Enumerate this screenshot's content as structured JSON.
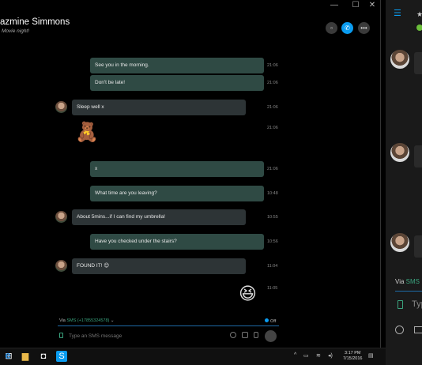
{
  "window": {
    "controls": {
      "minimize": "—",
      "maximize": "☐",
      "close": "✕"
    },
    "header": {
      "contact_name": "azmine Simmons",
      "mood": "Movie night!"
    }
  },
  "messages": [
    {
      "dir": "out",
      "text": "See you in the morning.",
      "time": "21:06"
    },
    {
      "dir": "out",
      "text": "Don't be late!",
      "time": "21:06"
    },
    {
      "dir": "in",
      "text": "Sleep well x",
      "time": "21:06"
    },
    {
      "dir": "in",
      "emoticon": "teddy-bear",
      "time": "21:06"
    },
    {
      "dir": "out",
      "text": "x",
      "time": "21:06"
    },
    {
      "dir": "out",
      "text": "What time are you leaving?",
      "time": "10:48"
    },
    {
      "dir": "in",
      "text": "About 5mins...if I can find my umbrella!",
      "time": "10:55"
    },
    {
      "dir": "out",
      "text": "Have you checked under the stairs?",
      "time": "10:56"
    },
    {
      "dir": "in",
      "text": "FOUND IT! 😊",
      "time": "11:04"
    },
    {
      "dir": "out",
      "emoticon": "laughing-face",
      "time": "11:05"
    }
  ],
  "composer": {
    "via_label": "Via",
    "via_value": "SMS (+17855324578)",
    "toggle_label": "Off",
    "placeholder": "Type an SMS message"
  },
  "taskbar": {
    "time": "3:17 PM",
    "date": "7/15/2016"
  },
  "pane": {
    "via_label": "Via",
    "via_value": "SMS",
    "placeholder": "Typ"
  }
}
